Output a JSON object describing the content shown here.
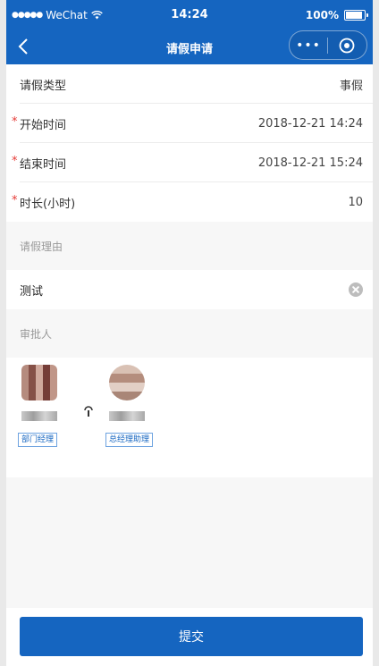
{
  "status_bar": {
    "signal": "●●●●●",
    "carrier": "WeChat",
    "time": "14:24",
    "battery_text": "100%",
    "battery_level": 1.0
  },
  "nav": {
    "title": "请假申请",
    "more_glyph": "•••"
  },
  "form": {
    "leave_type": {
      "label": "请假类型",
      "value": "事假"
    },
    "start_time": {
      "label": "开始时间",
      "value": "2018-12-21 14:24",
      "required": "*"
    },
    "end_time": {
      "label": "结束时间",
      "value": "2018-12-21 15:24",
      "required": "*"
    },
    "duration": {
      "label": "时长(小时)",
      "value": "10",
      "required": "*"
    }
  },
  "reason": {
    "header": "请假理由",
    "value": "测试"
  },
  "approvers": {
    "header": "审批人",
    "items": [
      {
        "role": "部门经理"
      },
      {
        "role": "总经理助理"
      }
    ]
  },
  "footer": {
    "submit_label": "提交"
  },
  "colors": {
    "brand": "#1565c0",
    "required": "#e53935",
    "tag_border": "#6ea3e0"
  }
}
